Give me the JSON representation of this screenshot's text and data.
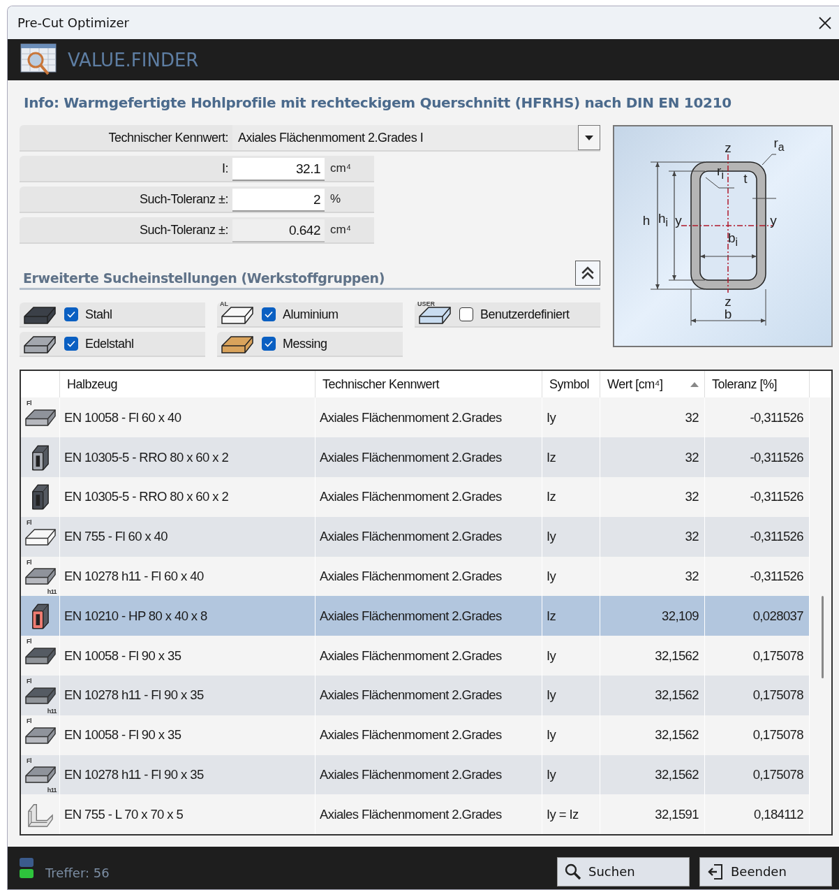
{
  "window": {
    "title": "Pre-Cut Optimizer"
  },
  "header": {
    "title": "VALUE.FINDER"
  },
  "info": "Info: Warmgefertigte Hohlprofile mit rechteckigem Querschnitt (HFRHS) nach DIN EN 10210",
  "parameter": {
    "label": "Technischer Kennwert:",
    "value": "Axiales Flächenmoment 2.Grades I"
  },
  "fields": [
    {
      "label": "I:",
      "value": "32.1",
      "unit": "cm⁴",
      "editable": true
    },
    {
      "label": "Such-Toleranz ±:",
      "value": "2",
      "unit": "%",
      "editable": true
    },
    {
      "label": "Such-Toleranz ±:",
      "value": "0.642",
      "unit": "cm⁴",
      "editable": false
    }
  ],
  "section": {
    "title": "Erweiterte Sucheinstellungen (Werkstoffgruppen)",
    "expanded": true
  },
  "materials": [
    {
      "name": "Stahl",
      "checked": true,
      "color": "#3b4048"
    },
    {
      "name": "Aluminium",
      "checked": true,
      "color": "#f8f8f8",
      "tag": "AL"
    },
    {
      "name": "Benutzerdefiniert",
      "checked": false,
      "color": "#c9dcf0",
      "tag": "USER"
    },
    {
      "name": "Edelstahl",
      "checked": true,
      "color": "#a3a7ae"
    },
    {
      "name": "Messing",
      "checked": true,
      "color": "#d9a35c"
    }
  ],
  "diagram": {
    "labels": [
      "z",
      "r$_{a}$",
      "r$_{i}$",
      "t",
      "h",
      "h$_{i}$",
      "y",
      "y",
      "b$_{i}$",
      "z",
      "b"
    ]
  },
  "table": {
    "columns": [
      {
        "title": "Halbzeug"
      },
      {
        "title": "Technischer Kennwert"
      },
      {
        "title": "Symbol"
      },
      {
        "title": "Wert [cm⁴]",
        "sorted": true
      },
      {
        "title": "Toleranz [%]"
      }
    ],
    "rows": [
      {
        "icon": {
          "kind": "flat",
          "color": "#8f939b",
          "top": "Fl"
        },
        "halbzeug": "EN 10058 - Fl 60 x 40",
        "kennwert": "Axiales Flächenmoment 2.Grades",
        "symbol": "Iy",
        "wert": "32",
        "toleranz": "-0,311526",
        "selected": false
      },
      {
        "icon": {
          "kind": "tube",
          "color": "#a4a8b0"
        },
        "halbzeug": "EN 10305-5 - RRO 80 x 60 x 2",
        "kennwert": "Axiales Flächenmoment 2.Grades",
        "symbol": "Iz",
        "wert": "32",
        "toleranz": "-0,311526",
        "selected": false
      },
      {
        "icon": {
          "kind": "tube",
          "color": "#454a52"
        },
        "halbzeug": "EN 10305-5 - RRO 80 x 60 x 2",
        "kennwert": "Axiales Flächenmoment 2.Grades",
        "symbol": "Iz",
        "wert": "32",
        "toleranz": "-0,311526",
        "selected": false
      },
      {
        "icon": {
          "kind": "flat",
          "color": "#f6f6f6",
          "top": "Fl"
        },
        "halbzeug": "EN 755 - Fl 60 x 40",
        "kennwert": "Axiales Flächenmoment 2.Grades",
        "symbol": "Iy",
        "wert": "32",
        "toleranz": "-0,311526",
        "selected": false
      },
      {
        "icon": {
          "kind": "flat",
          "color": "#8f939b",
          "top": "Fl",
          "bottom": "h11"
        },
        "halbzeug": "EN 10278 h11 - Fl 60 x 40",
        "kennwert": "Axiales Flächenmoment 2.Grades",
        "symbol": "Iy",
        "wert": "32",
        "toleranz": "-0,311526",
        "selected": false
      },
      {
        "icon": {
          "kind": "tube",
          "color": "#ee7c72"
        },
        "halbzeug": "EN 10210 - HP 80 x 40 x 8",
        "kennwert": "Axiales Flächenmoment 2.Grades",
        "symbol": "Iz",
        "wert": "32,109",
        "toleranz": "0,028037",
        "selected": true
      },
      {
        "icon": {
          "kind": "flat",
          "color": "#555b63",
          "top": "Fl"
        },
        "halbzeug": "EN 10058 - Fl 90 x 35",
        "kennwert": "Axiales Flächenmoment 2.Grades",
        "symbol": "Iy",
        "wert": "32,1562",
        "toleranz": "0,175078",
        "selected": false
      },
      {
        "icon": {
          "kind": "flat",
          "color": "#555b63",
          "top": "Fl",
          "bottom": "h11"
        },
        "halbzeug": "EN 10278 h11 - Fl 90 x 35",
        "kennwert": "Axiales Flächenmoment 2.Grades",
        "symbol": "Iy",
        "wert": "32,1562",
        "toleranz": "0,175078",
        "selected": false
      },
      {
        "icon": {
          "kind": "flat",
          "color": "#8f939b",
          "top": "Fl"
        },
        "halbzeug": "EN 10058 - Fl 90 x 35",
        "kennwert": "Axiales Flächenmoment 2.Grades",
        "symbol": "Iy",
        "wert": "32,1562",
        "toleranz": "0,175078",
        "selected": false
      },
      {
        "icon": {
          "kind": "flat",
          "color": "#8f939b",
          "top": "Fl",
          "bottom": "h11"
        },
        "halbzeug": "EN 10278 h11 - Fl 90 x 35",
        "kennwert": "Axiales Flächenmoment 2.Grades",
        "symbol": "Iy",
        "wert": "32,1562",
        "toleranz": "0,175078",
        "selected": false
      },
      {
        "icon": {
          "kind": "angle",
          "color": "#e4e4e4"
        },
        "halbzeug": "EN 755 - L 70 x 70 x 5",
        "kennwert": "Axiales Flächenmoment 2.Grades",
        "symbol": "Iy = Iz",
        "wert": "32,1591",
        "toleranz": "0,184112",
        "selected": false
      }
    ]
  },
  "status": {
    "text": "Treffer: 56"
  },
  "buttons": [
    {
      "label": "Suchen",
      "kind": "search"
    },
    {
      "label": "Beenden",
      "kind": "exit"
    }
  ]
}
